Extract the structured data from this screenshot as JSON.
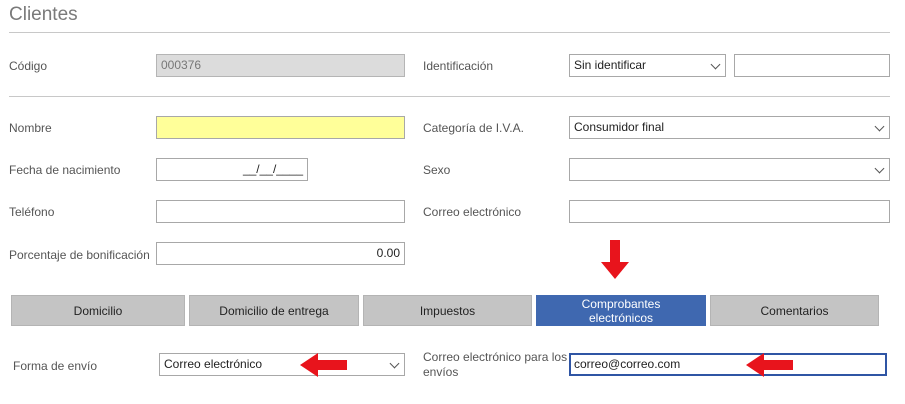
{
  "page": {
    "title": "Clientes"
  },
  "fields": {
    "codigo": {
      "label": "Código",
      "value": "000376"
    },
    "identificacion": {
      "label": "Identificación",
      "selected": "Sin identificar",
      "number": ""
    },
    "nombre": {
      "label": "Nombre",
      "value": ""
    },
    "categoria_iva": {
      "label": "Categoría de I.V.A.",
      "selected": "Consumidor final"
    },
    "fecha_nacimiento": {
      "label": "Fecha de nacimiento",
      "value": "__/__/____"
    },
    "sexo": {
      "label": "Sexo",
      "selected": ""
    },
    "telefono": {
      "label": "Teléfono",
      "value": ""
    },
    "correo": {
      "label": "Correo electrónico",
      "value": ""
    },
    "bonificacion": {
      "label": "Porcentaje de bonificación",
      "value": "0.00"
    }
  },
  "tabs": [
    {
      "label": "Domicilio"
    },
    {
      "label": "Domicilio de entrega"
    },
    {
      "label": "Impuestos"
    },
    {
      "label": "Comprobantes electrónicos",
      "active": true
    },
    {
      "label": "Comentarios"
    }
  ],
  "envio": {
    "forma_label": "Forma de envío",
    "forma_selected": "Correo electrónico",
    "correo_label": "Correo electrónico para los envíos",
    "correo_value": "correo@correo.com"
  },
  "colors": {
    "accent": "#3f68b0",
    "highlight_yellow": "#ffff99",
    "arrow_red": "#e8141c"
  },
  "icons": {
    "dropdown": "chevron-down-icon",
    "annotation": "red-arrow-icon"
  }
}
